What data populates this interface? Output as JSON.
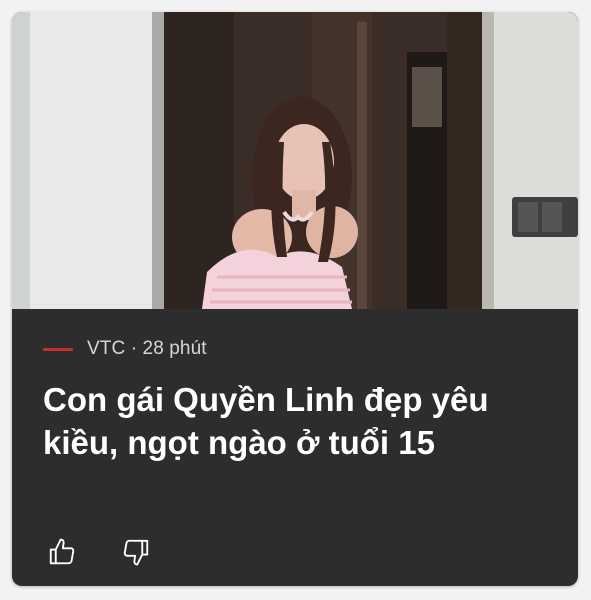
{
  "article": {
    "source": "VTC",
    "time": "28 phút",
    "meta_separator": "·",
    "headline": "Con gái Quyền Linh đẹp yêu kiều, ngọt ngào ở tuổi 15",
    "image_icon": "photo-portrait-girl"
  },
  "actions": {
    "like_icon": "thumbs-up-icon",
    "dislike_icon": "thumbs-down-icon"
  },
  "colors": {
    "card_bg": "#2d2d2d",
    "source_accent": "#c4302b",
    "meta_text": "#d6d6d6",
    "headline_text": "#ffffff"
  }
}
